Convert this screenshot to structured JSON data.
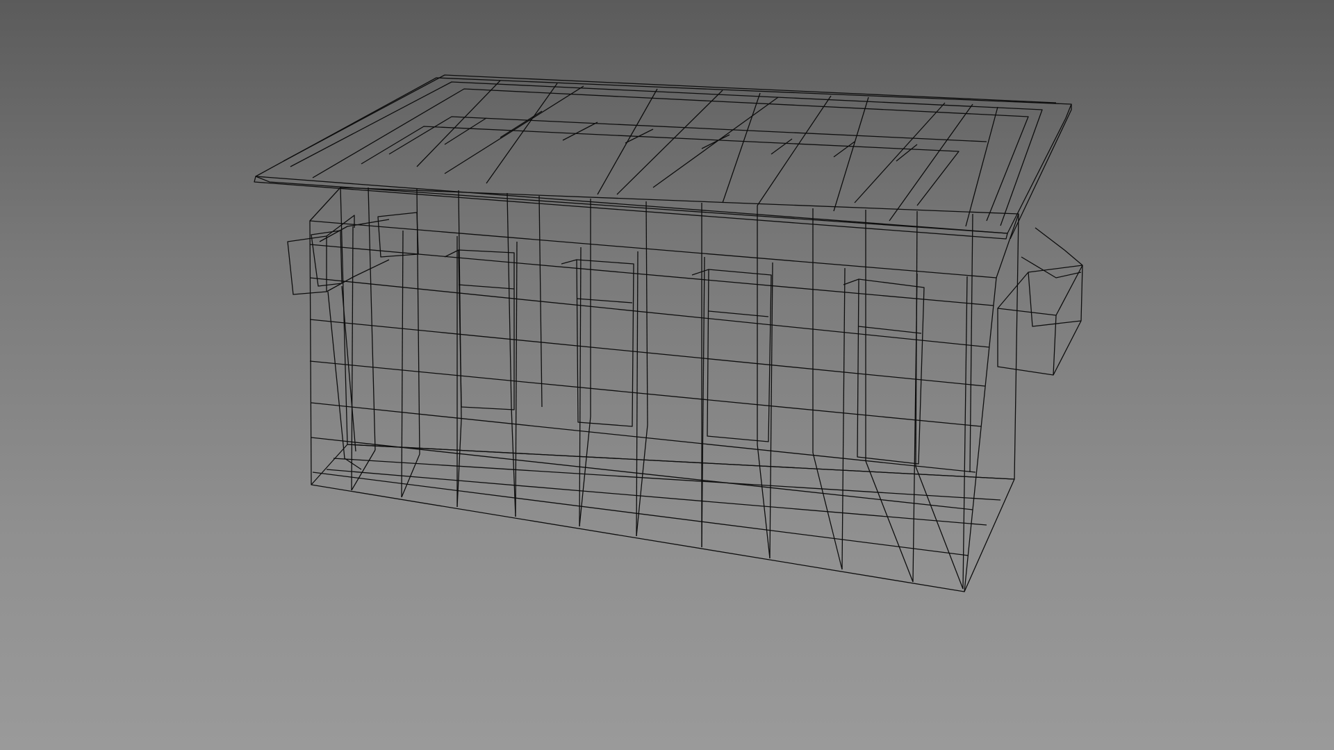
{
  "scene": {
    "view_mode": "wireframe",
    "object": "dumpster",
    "colors": {
      "background_top": "#5b5b5b",
      "background_bottom": "#9a9a9a",
      "wire": "#0d0d0d"
    }
  }
}
